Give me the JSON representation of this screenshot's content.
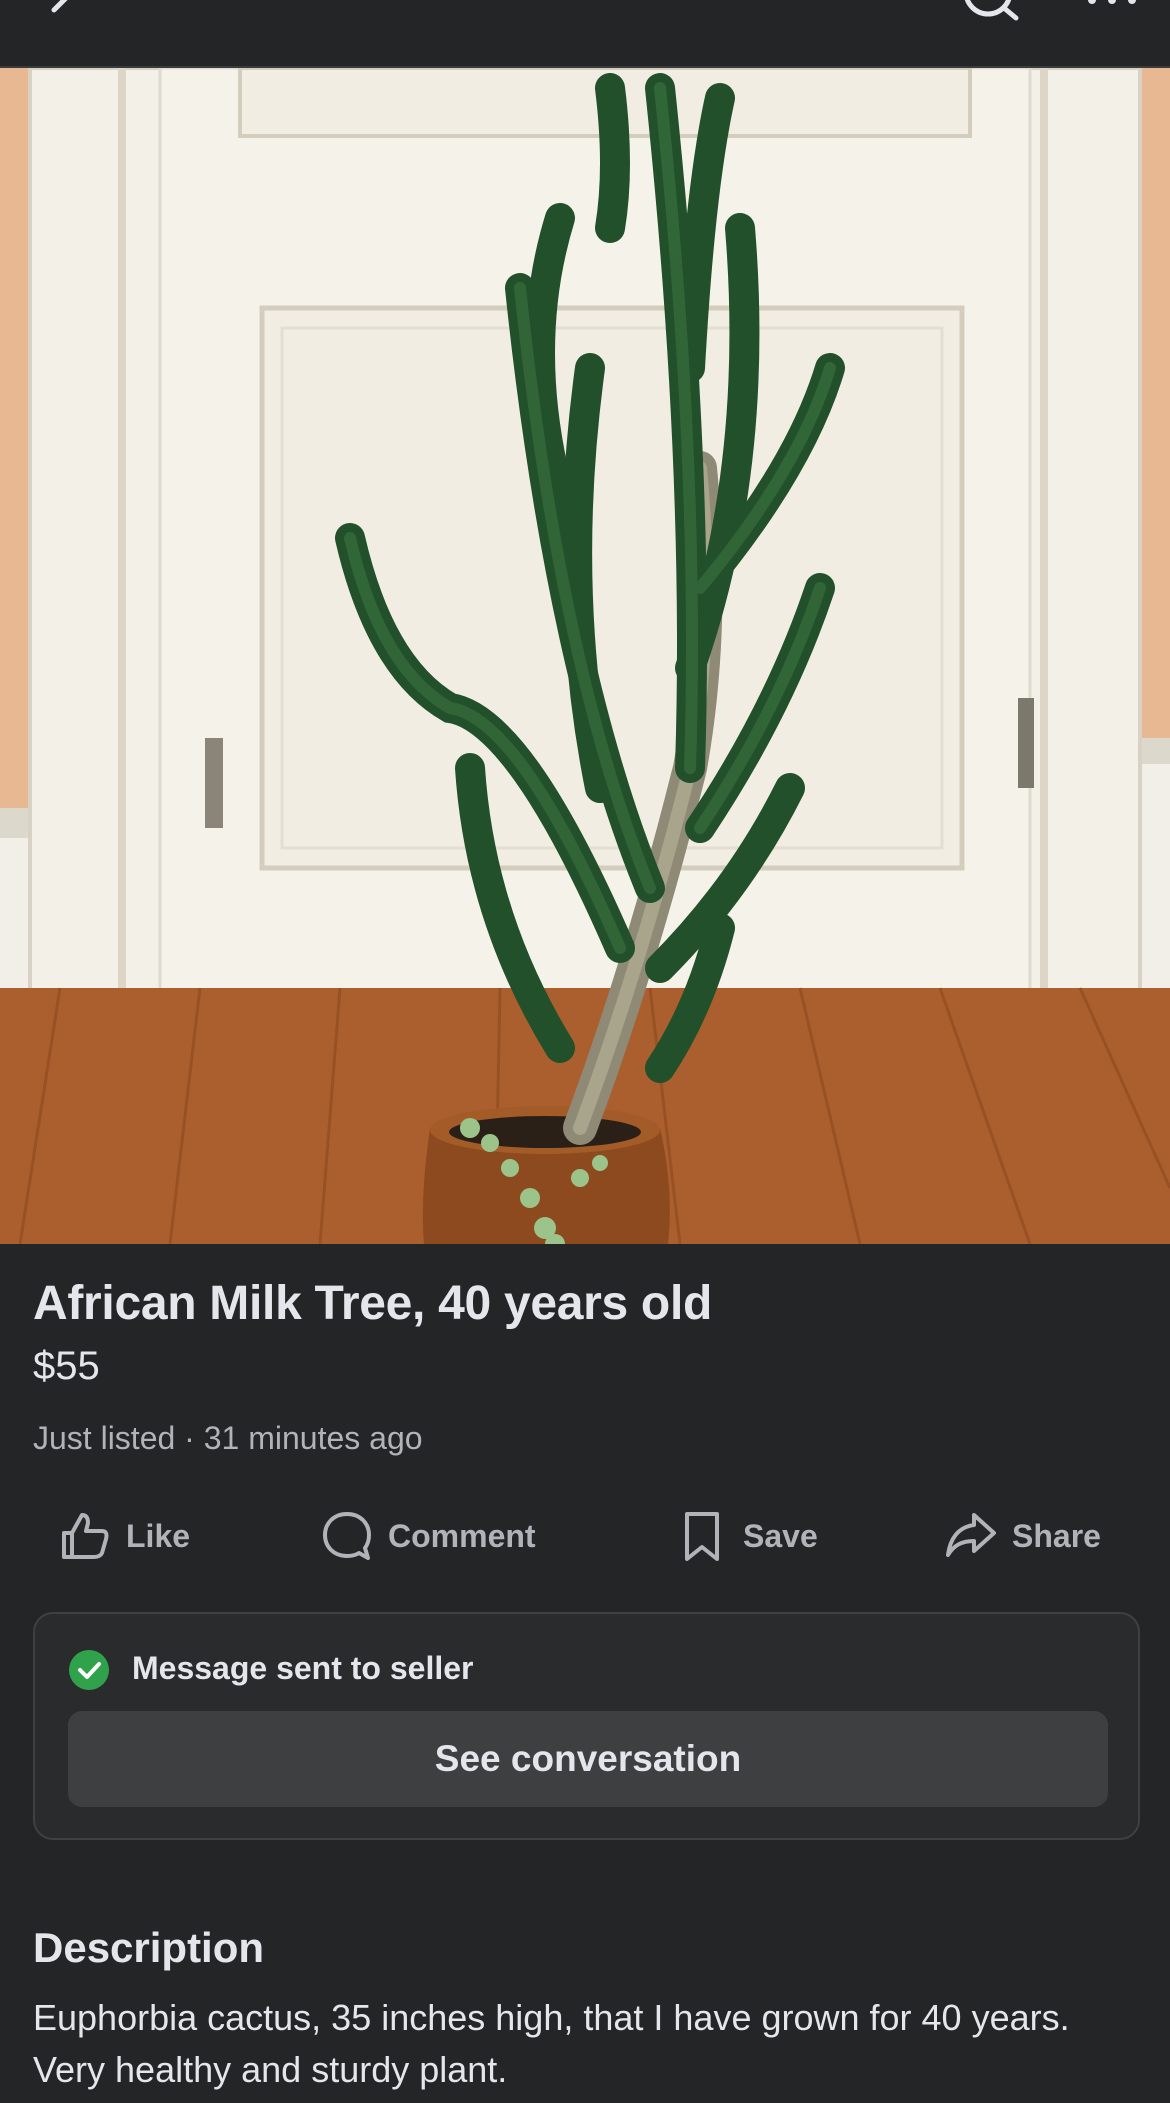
{
  "listing": {
    "title": "African Milk Tree, 40 years old",
    "price": "$55",
    "listed_status": "Just listed",
    "separator": "·",
    "listed_time": "31 minutes ago",
    "photo_icon": "euphorbia-plant-photo"
  },
  "actions": [
    {
      "label": "Like",
      "icon": "thumbs-up-icon"
    },
    {
      "label": "Comment",
      "icon": "comment-icon"
    },
    {
      "label": "Save",
      "icon": "bookmark-icon"
    },
    {
      "label": "Share",
      "icon": "share-icon"
    }
  ],
  "message": {
    "status": "Message sent to seller",
    "button_label": "See conversation",
    "check_color": "#31a24c"
  },
  "description": {
    "heading": "Description",
    "text": "Euphorbia cactus, 35 inches high, that I have grown for 40 years. Very healthy and sturdy plant."
  },
  "theme": {
    "background": "#242526",
    "text_primary": "#e4e6eb",
    "text_secondary": "#b0b3b8",
    "button_bg": "#3e3f41"
  }
}
